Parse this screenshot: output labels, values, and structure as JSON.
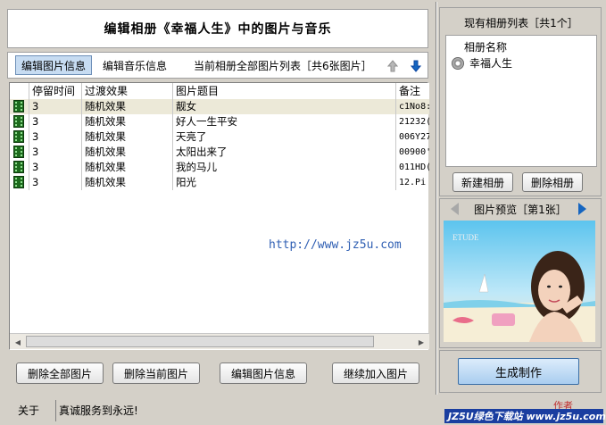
{
  "title": "编辑相册《幸福人生》中的图片与音乐",
  "tabs": [
    {
      "label": "编辑图片信息",
      "active": true
    },
    {
      "label": "编辑音乐信息",
      "active": false
    }
  ],
  "list_caption": "当前相册全部图片列表［共6张图片］",
  "table": {
    "columns": [
      "停留时间",
      "过渡效果",
      "图片题目",
      "备注"
    ],
    "rows": [
      {
        "time": "3",
        "effect": "随机效果",
        "title": "靓女",
        "note": "c1No8:"
      },
      {
        "time": "3",
        "effect": "随机效果",
        "title": "好人一生平安",
        "note": "21232("
      },
      {
        "time": "3",
        "effect": "随机效果",
        "title": "天亮了",
        "note": "006Y27"
      },
      {
        "time": "3",
        "effect": "随机效果",
        "title": "太阳出来了",
        "note": "00900'"
      },
      {
        "time": "3",
        "effect": "随机效果",
        "title": "我的马儿",
        "note": "011HD("
      },
      {
        "time": "3",
        "effect": "随机效果",
        "title": "阳光",
        "note": "12.Pi"
      }
    ]
  },
  "watermark_url": "http://www.jz5u.com",
  "buttons": {
    "delete_all": "删除全部图片",
    "delete_current": "删除当前图片",
    "edit_info": "编辑图片信息",
    "continue_add": "继续加入图片",
    "new_album": "新建相册",
    "delete_album": "删除相册",
    "make": "生成制作"
  },
  "albums": {
    "title": "现有相册列表［共1个］",
    "column": "相册名称",
    "items": [
      "幸福人生"
    ]
  },
  "preview": {
    "label": "图片预览［第1张］",
    "logo_text": "ETUDE"
  },
  "status": {
    "about": "关于",
    "message": "真诚服务到永远!",
    "brand": "JZ5U绿色下载站 www.jz5u.com",
    "author": "作者"
  },
  "colors": {
    "window_bg": "#d4d0c8",
    "selection": "#ece9d8",
    "accent_blue": "#1565c0",
    "url_color": "#2f5fb3"
  }
}
